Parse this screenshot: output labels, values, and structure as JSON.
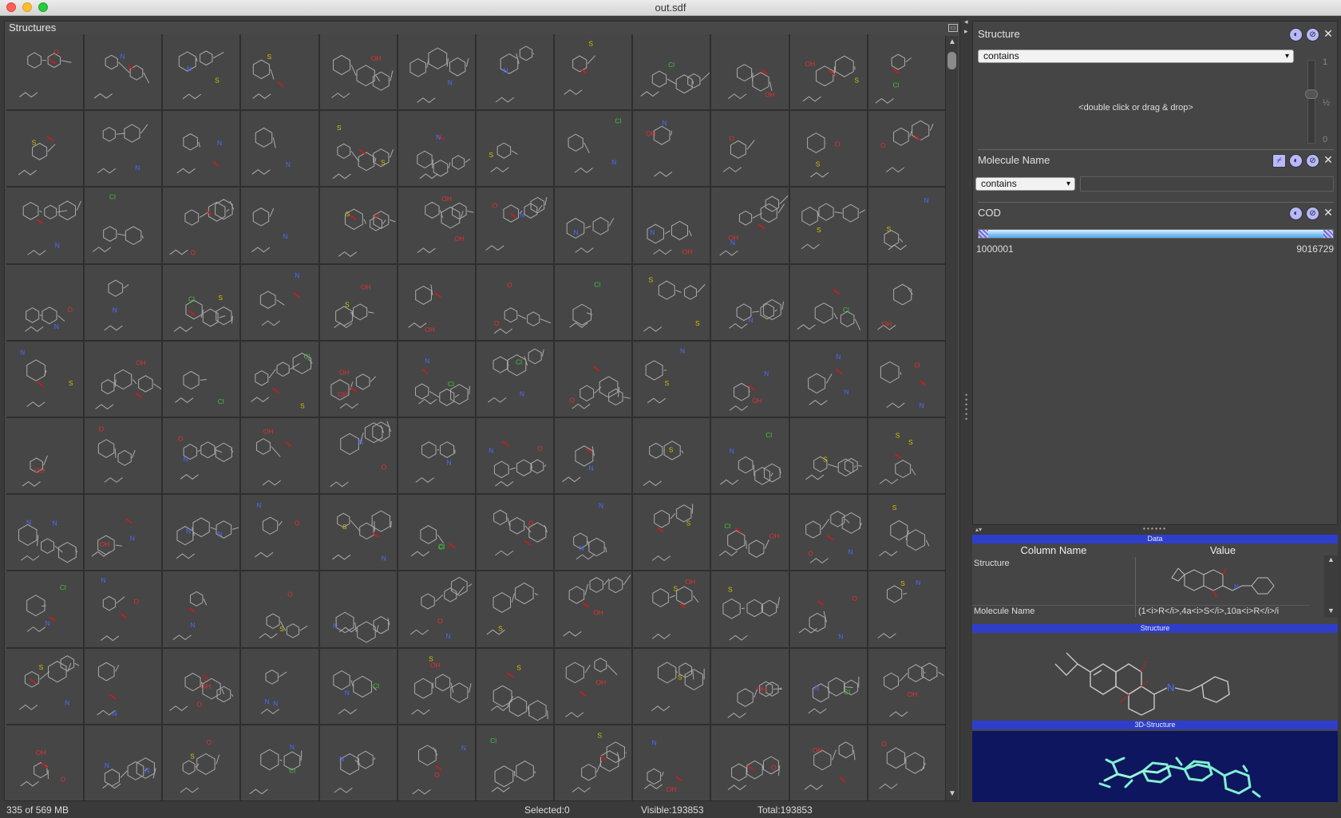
{
  "window": {
    "title": "out.sdf"
  },
  "structures_panel": {
    "title": "Structures"
  },
  "filters": {
    "structure": {
      "title": "Structure",
      "mode": "contains",
      "hint": "<double click or drag & drop>",
      "scale_labels": [
        "1",
        "½",
        "0"
      ]
    },
    "molecule_name": {
      "title": "Molecule Name",
      "mode": "contains",
      "value": ""
    },
    "cod": {
      "title": "COD",
      "min": "1000001",
      "max": "9016729"
    }
  },
  "details": {
    "data_band": "Data",
    "headers": {
      "column_name": "Column Name",
      "value": "Value"
    },
    "rows": [
      {
        "name": "Structure",
        "value": ""
      },
      {
        "name": "Molecule Name",
        "value": "(1<i>R</i>,4a<i>S</i>,10a<i>R</i>/i"
      }
    ],
    "structure_band": "Structure",
    "structure3d_band": "3D-Structure"
  },
  "status": {
    "memory": "335 of 569 MB",
    "selected": "Selected:0",
    "visible": "Visible:193853",
    "total": "Total:193853"
  },
  "colors": {
    "accent_blue": "#2f3ec9",
    "panel_bg": "#454545",
    "cell_bg": "#464646",
    "bond_red": "#c02020",
    "nitrogen_blue": "#4b6bff",
    "sulfur_yellow": "#d4c000",
    "chlorine_green": "#3fc23f",
    "mol3d_cyan": "#7ff0d0"
  },
  "icons": [
    "close-icon",
    "invert-filter-icon",
    "disable-filter-icon",
    "edit-filter-icon",
    "maximize-icon"
  ],
  "grid": {
    "rows": 10,
    "cols": 12
  }
}
